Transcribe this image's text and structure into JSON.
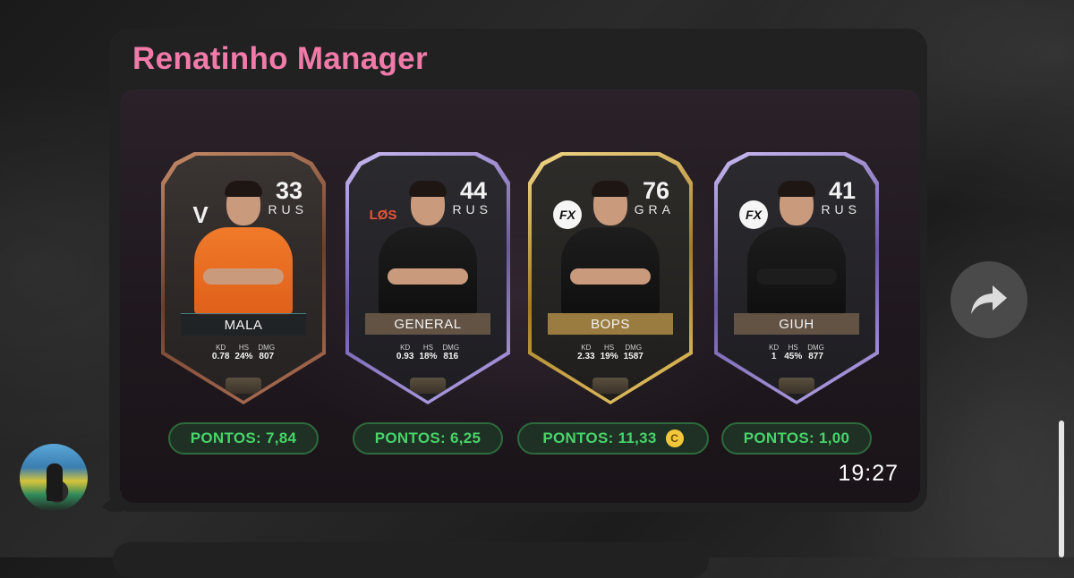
{
  "message": {
    "sender": "Renatinho Manager",
    "time": "19:27"
  },
  "cards": [
    {
      "rating": "33",
      "nation": "RUS",
      "team_logo": "V",
      "name": "MALA",
      "stats": {
        "kd_label": "KD",
        "kd": "0.78",
        "hs_label": "HS",
        "hs": "24%",
        "dmg_label": "DMG",
        "dmg": "807"
      },
      "points": "PONTOS: 7,84",
      "tier": "bronze"
    },
    {
      "rating": "44",
      "nation": "RUS",
      "team_logo": "LØS",
      "name": "GENERAL",
      "stats": {
        "kd_label": "KD",
        "kd": "0.93",
        "hs_label": "HS",
        "hs": "18%",
        "dmg_label": "DMG",
        "dmg": "816"
      },
      "points": "PONTOS: 6,25",
      "tier": "purple"
    },
    {
      "rating": "76",
      "nation": "GRA",
      "team_logo": "FX",
      "name": "BOPS",
      "stats": {
        "kd_label": "KD",
        "kd": "2.33",
        "hs_label": "HS",
        "hs": "19%",
        "dmg_label": "DMG",
        "dmg": "1587"
      },
      "points": "PONTOS: 11,33",
      "captain": "C",
      "tier": "gold"
    },
    {
      "rating": "41",
      "nation": "RUS",
      "team_logo": "FX",
      "name": "GIUH",
      "stats": {
        "kd_label": "KD",
        "kd": "1",
        "hs_label": "HS",
        "hs": "45%",
        "dmg_label": "DMG",
        "dmg": "877"
      },
      "points": "PONTOS: 1,00",
      "tier": "purple"
    }
  ],
  "icons": {
    "forward": "forward-arrow-icon",
    "avatar": "sender-avatar"
  },
  "colors": {
    "sender_name": "#f07aa8",
    "points_text": "#49d36a",
    "points_border": "#2d6b3d",
    "bubble_bg": "#212121"
  }
}
